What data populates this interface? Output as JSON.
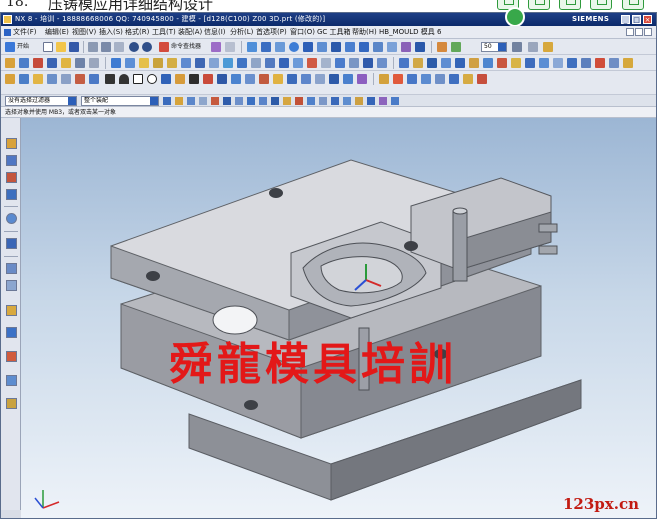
{
  "doc_heading": {
    "number": "18.",
    "text": "压铸模应用详细结构设计"
  },
  "window": {
    "title": "NX 8 - 培训 - 18888668006 QQ: 740945800 - 建模 - [d128(C100) Z00 3D.prt (修改的)]",
    "brand": "SIEMENS",
    "controls": [
      "_",
      "□",
      "×"
    ]
  },
  "menus": [
    "文件(F)",
    "编辑(E)",
    "视图(V)",
    "插入(S)",
    "格式(R)",
    "工具(T)",
    "装配(A)",
    "信息(I)",
    "分析(L)",
    "首选项(P)",
    "窗口(O)",
    "GC 工具箱",
    "帮助(H)",
    "HB_MOULD 模具 6"
  ],
  "toolbar": {
    "start_label": "开始",
    "command_finder_label": "命令查找器",
    "zoom_value": "50"
  },
  "filter": {
    "selection_scope": "没有选择过滤器",
    "assembly_scope": "整个装配"
  },
  "cue_line": "选择对象并使用 MB3，或者双击某一对象",
  "watermark": "舜龍模具培訓",
  "site_mark": "123px.cn",
  "icons": [
    "start-icon",
    "new-icon",
    "open-icon",
    "save-icon",
    "cut-icon",
    "copy-icon",
    "paste-icon",
    "undo-icon",
    "redo-icon",
    "command-finder-icon",
    "fit-icon",
    "zoom-icon",
    "rotate-icon",
    "shaded-icon",
    "extrude-icon",
    "hole-icon",
    "blend-icon",
    "chamfer-icon",
    "sketch-icon",
    "line-icon",
    "arc-icon",
    "rectangle-icon",
    "text-icon",
    "snap-icon",
    "csys-icon"
  ],
  "colors": {
    "title_bar": "#0c2a6a",
    "watermark": "#e31818",
    "viewport_top": "#9cb6d4",
    "viewport_bottom": "#eef3f9",
    "part": "#dcdde1"
  }
}
